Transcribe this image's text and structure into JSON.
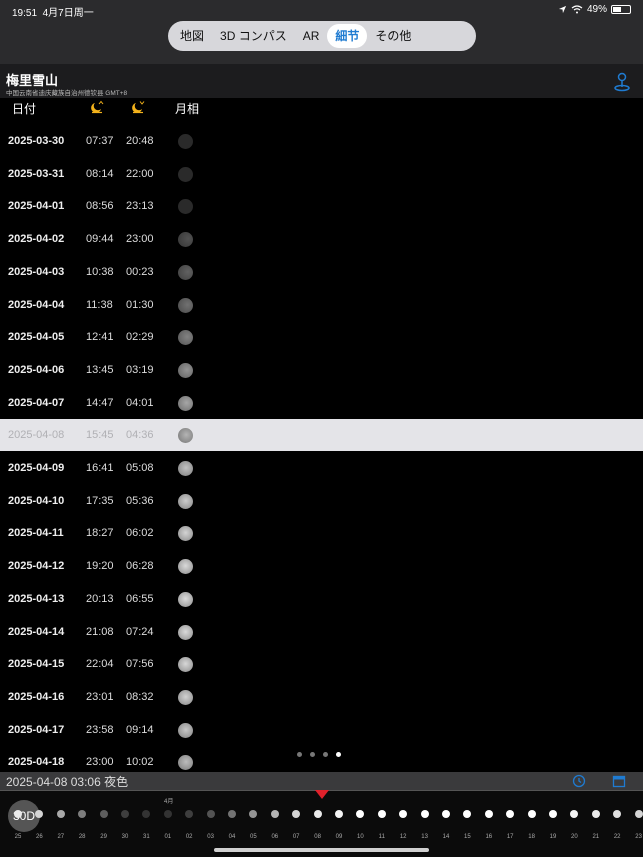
{
  "status": {
    "time": "19:51",
    "date": "4月7日周一",
    "battery": "49%"
  },
  "tabs": [
    {
      "label": "地図",
      "active": false
    },
    {
      "label": "3D コンパス",
      "active": false
    },
    {
      "label": "AR",
      "active": false
    },
    {
      "label": "細节",
      "active": true
    },
    {
      "label": "その他",
      "active": false
    }
  ],
  "location": {
    "name": "梅里雪山",
    "subtitle": "中国云南省迪庆藏族自治州德钦县 GMT+8"
  },
  "columns": {
    "date": "日付",
    "moon_phase": "月相"
  },
  "rows": [
    {
      "date": "2025-03-30",
      "rise": "07:37",
      "set": "20:48",
      "phase": 0.01,
      "selected": false
    },
    {
      "date": "2025-03-31",
      "rise": "08:14",
      "set": "22:00",
      "phase": 0.03,
      "selected": false
    },
    {
      "date": "2025-04-01",
      "rise": "08:56",
      "set": "23:13",
      "phase": 0.07,
      "selected": false
    },
    {
      "date": "2025-04-02",
      "rise": "09:44",
      "set": "23:00",
      "phase": 0.14,
      "selected": false
    },
    {
      "date": "2025-04-03",
      "rise": "10:38",
      "set": "00:23",
      "phase": 0.23,
      "selected": false
    },
    {
      "date": "2025-04-04",
      "rise": "11:38",
      "set": "01:30",
      "phase": 0.33,
      "selected": false
    },
    {
      "date": "2025-04-05",
      "rise": "12:41",
      "set": "02:29",
      "phase": 0.44,
      "selected": false
    },
    {
      "date": "2025-04-06",
      "rise": "13:45",
      "set": "03:19",
      "phase": 0.55,
      "selected": false
    },
    {
      "date": "2025-04-07",
      "rise": "14:47",
      "set": "04:01",
      "phase": 0.66,
      "selected": false
    },
    {
      "date": "2025-04-08",
      "rise": "15:45",
      "set": "04:36",
      "phase": 0.75,
      "selected": true
    },
    {
      "date": "2025-04-09",
      "rise": "16:41",
      "set": "05:08",
      "phase": 0.83,
      "selected": false
    },
    {
      "date": "2025-04-10",
      "rise": "17:35",
      "set": "05:36",
      "phase": 0.9,
      "selected": false
    },
    {
      "date": "2025-04-11",
      "rise": "18:27",
      "set": "06:02",
      "phase": 0.95,
      "selected": false
    },
    {
      "date": "2025-04-12",
      "rise": "19:20",
      "set": "06:28",
      "phase": 0.98,
      "selected": false
    },
    {
      "date": "2025-04-13",
      "rise": "20:13",
      "set": "06:55",
      "phase": 1.0,
      "selected": false
    },
    {
      "date": "2025-04-14",
      "rise": "21:08",
      "set": "07:24",
      "phase": 0.99,
      "selected": false
    },
    {
      "date": "2025-04-15",
      "rise": "22:04",
      "set": "07:56",
      "phase": 0.97,
      "selected": false
    },
    {
      "date": "2025-04-16",
      "rise": "23:01",
      "set": "08:32",
      "phase": 0.93,
      "selected": false
    },
    {
      "date": "2025-04-17",
      "rise": "23:58",
      "set": "09:14",
      "phase": 0.87,
      "selected": false
    },
    {
      "date": "2025-04-18",
      "rise": "23:00",
      "set": "10:02",
      "phase": 0.8,
      "selected": false
    }
  ],
  "page_dots": {
    "count": 4,
    "active": 3
  },
  "timeline": {
    "current": "2025-04-08 03:06 夜色",
    "button": "30D",
    "month_label": "4月",
    "days": [
      "25",
      "26",
      "27",
      "28",
      "29",
      "30",
      "31",
      "01",
      "02",
      "03",
      "04",
      "05",
      "06",
      "07",
      "08",
      "09",
      "10",
      "11",
      "12",
      "13",
      "14",
      "15",
      "16",
      "17",
      "18",
      "19",
      "20",
      "21",
      "22",
      "23"
    ],
    "brightness": [
      0.9,
      0.8,
      0.6,
      0.4,
      0.25,
      0.1,
      0.05,
      0.05,
      0.1,
      0.2,
      0.35,
      0.5,
      0.65,
      0.8,
      0.9,
      0.95,
      1,
      1,
      1,
      1,
      1,
      1,
      1,
      1,
      1,
      1,
      0.95,
      0.9,
      0.85,
      0.8
    ]
  },
  "colors": {
    "accent": "#1f7bd1",
    "marker": "#e0212b",
    "selected_row": "#e4e4e8"
  }
}
